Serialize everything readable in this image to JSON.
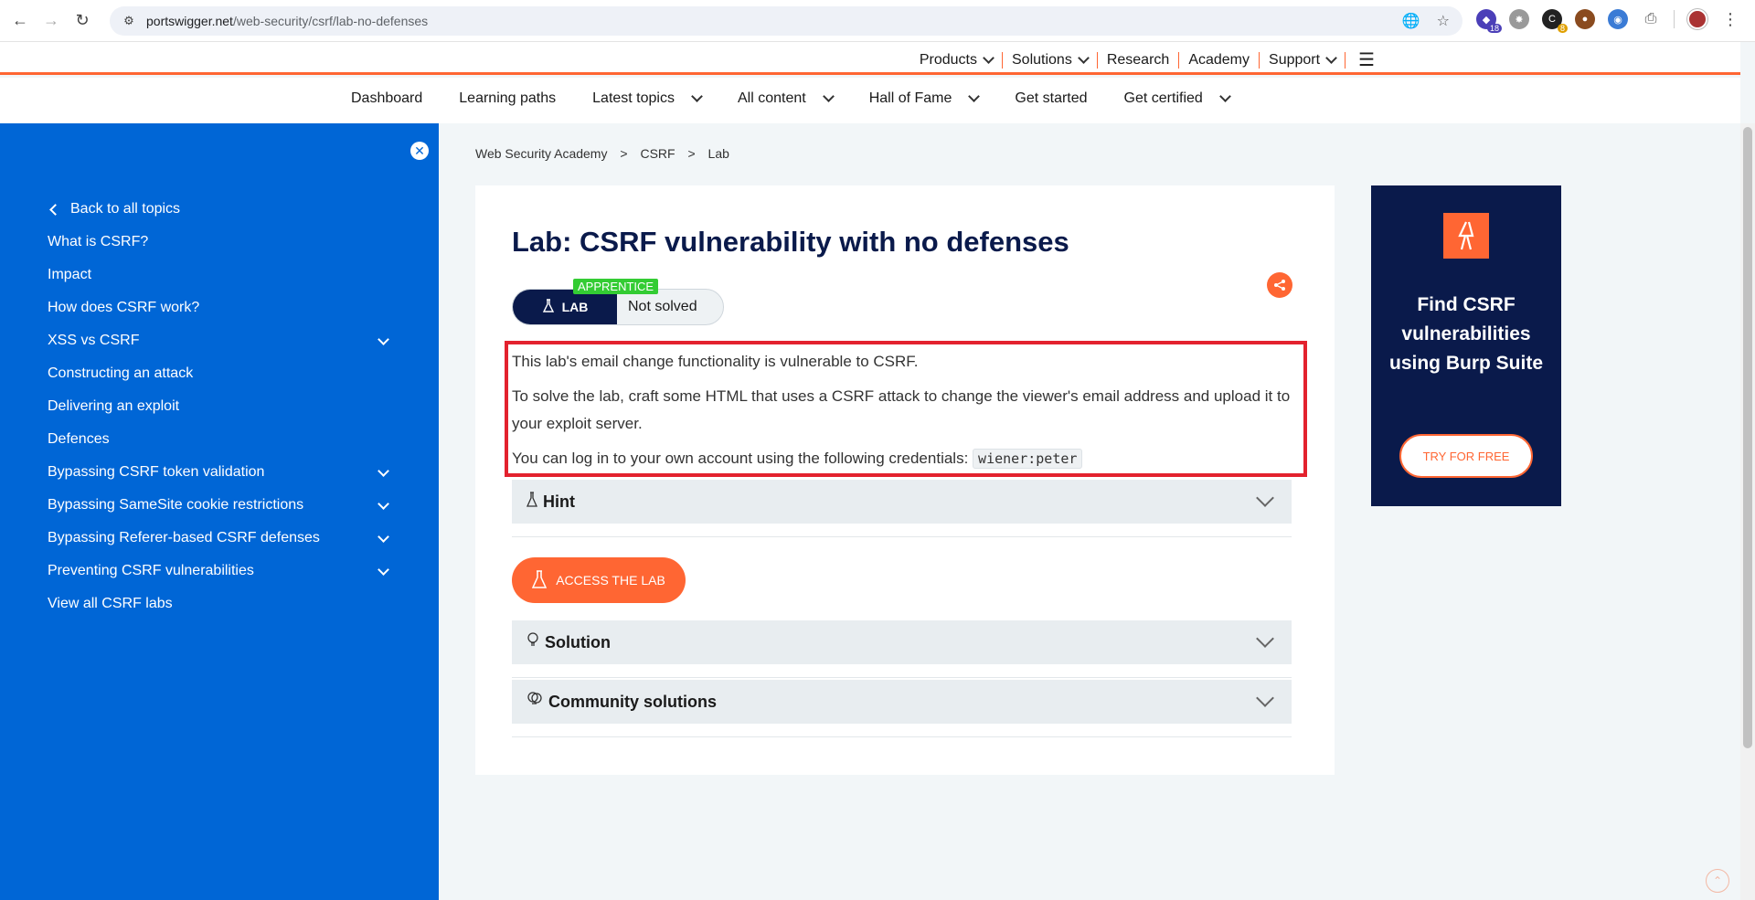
{
  "browser": {
    "url_host": "portswigger.net",
    "url_path": "/web-security/csrf/lab-no-defenses",
    "extensions": [
      {
        "name": "ext-1",
        "badge": "18",
        "color": "#4b3fb8"
      },
      {
        "name": "ext-2",
        "badge": "",
        "color": "#999999"
      },
      {
        "name": "ext-3",
        "badge": "8",
        "color": "#222222"
      },
      {
        "name": "ext-4",
        "badge": "",
        "color": "#8a4b1f"
      },
      {
        "name": "ext-5",
        "badge": "",
        "color": "#3a7bd5"
      }
    ]
  },
  "topnav": {
    "products": "Products",
    "solutions": "Solutions",
    "research": "Research",
    "academy": "Academy",
    "support": "Support"
  },
  "academy_nav": {
    "dashboard": "Dashboard",
    "learning_paths": "Learning paths",
    "latest_topics": "Latest topics",
    "all_content": "All content",
    "hall_of_fame": "Hall of Fame",
    "get_started": "Get started",
    "get_certified": "Get certified"
  },
  "sidebar": {
    "back": "Back to all topics",
    "items": [
      {
        "label": "What is CSRF?",
        "expandable": false
      },
      {
        "label": "Impact",
        "expandable": false
      },
      {
        "label": "How does CSRF work?",
        "expandable": false
      },
      {
        "label": "XSS vs CSRF",
        "expandable": true
      },
      {
        "label": "Constructing an attack",
        "expandable": false
      },
      {
        "label": "Delivering an exploit",
        "expandable": false
      },
      {
        "label": "Defences",
        "expandable": false
      },
      {
        "label": "Bypassing CSRF token validation",
        "expandable": true
      },
      {
        "label": "Bypassing SameSite cookie restrictions",
        "expandable": true
      },
      {
        "label": "Bypassing Referer-based CSRF defenses",
        "expandable": true
      },
      {
        "label": "Preventing CSRF vulnerabilities",
        "expandable": true
      },
      {
        "label": "View all CSRF labs",
        "expandable": false
      }
    ]
  },
  "breadcrumb": {
    "root": "Web Security Academy",
    "sep": ">",
    "section": "CSRF",
    "page": "Lab"
  },
  "lab": {
    "title": "Lab: CSRF vulnerability with no defenses",
    "level": "APPRENTICE",
    "pill_label": "LAB",
    "status": "Not solved",
    "desc_1": "This lab's email change functionality is vulnerable to CSRF.",
    "desc_2": "To solve the lab, craft some HTML that uses a CSRF attack to change the viewer's email address and upload it to your exploit server.",
    "desc_3": "You can log in to your own account using the following credentials:",
    "credentials": "wiener:peter",
    "hint": "Hint",
    "access": "ACCESS THE LAB",
    "solution": "Solution",
    "community": "Community solutions"
  },
  "ad": {
    "headline": "Find CSRF vulnerabilities using Burp Suite",
    "cta": "TRY FOR FREE"
  }
}
